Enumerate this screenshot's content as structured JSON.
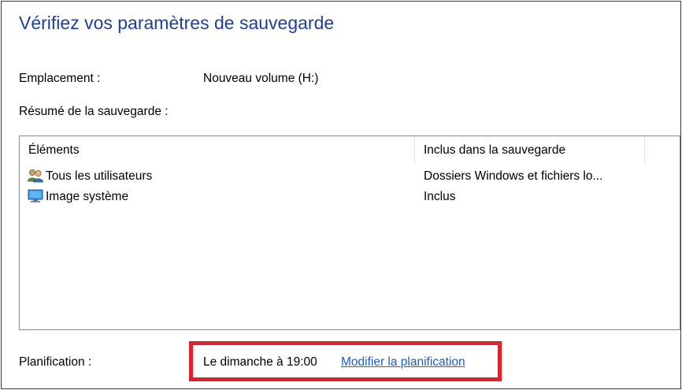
{
  "title": "Vérifiez vos paramètres de sauvegarde",
  "location": {
    "label": "Emplacement :",
    "value": "Nouveau volume (H:)"
  },
  "summary": {
    "label": "Résumé de la sauvegarde :"
  },
  "table": {
    "columns": [
      "Éléments",
      "Inclus dans la sauvegarde"
    ],
    "rows": [
      {
        "icon": "users-icon",
        "name": "Tous les utilisateurs",
        "included": "Dossiers Windows et fichiers lo..."
      },
      {
        "icon": "monitor-icon",
        "name": "Image système",
        "included": "Inclus"
      }
    ]
  },
  "schedule": {
    "label": "Planification :",
    "value": "Le dimanche à 19:00",
    "link": "Modifier la planification"
  },
  "colors": {
    "title": "#1e3f9a",
    "link": "#1a5cc8",
    "highlight": "#e0202b"
  }
}
